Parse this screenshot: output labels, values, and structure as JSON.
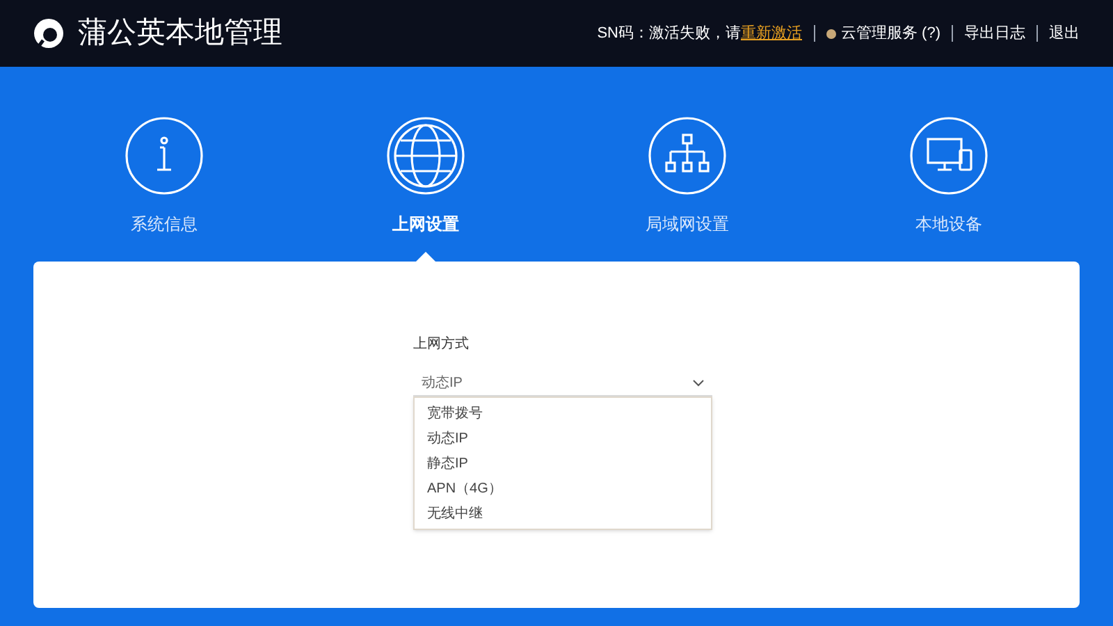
{
  "header": {
    "title": "蒲公英本地管理",
    "sn_label": "SN码：激活失败，请",
    "reactivate_link": "重新激活",
    "cloud_service": "云管理服务 (?)",
    "export_log": "导出日志",
    "logout": "退出"
  },
  "tabs": [
    {
      "label": "系统信息",
      "kind": "info",
      "selected": false
    },
    {
      "label": "上网设置",
      "kind": "globe",
      "selected": true
    },
    {
      "label": "局域网设置",
      "kind": "network",
      "selected": false
    },
    {
      "label": "本地设备",
      "kind": "devices",
      "selected": false
    }
  ],
  "form": {
    "label": "上网方式",
    "value": "动态IP",
    "options": [
      "宽带拨号",
      "动态IP",
      "静态IP",
      "APN（4G）",
      "无线中继"
    ]
  }
}
